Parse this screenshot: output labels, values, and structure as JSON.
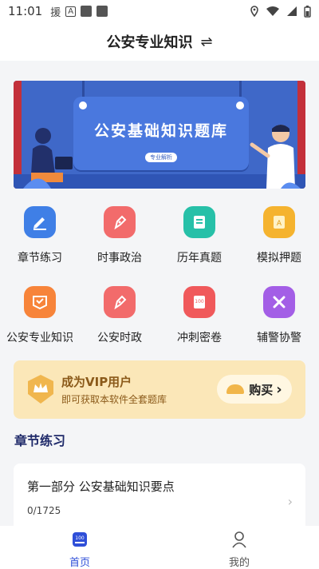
{
  "status_bar": {
    "time": "11:01",
    "notification_char": "援",
    "notification_a": "A"
  },
  "header": {
    "title": "公安专业知识",
    "switch_symbol": "⇌"
  },
  "banner": {
    "headline": "公安基础知识题库",
    "tag": "专业解析"
  },
  "grid": {
    "items": [
      {
        "label": "章节练习",
        "icon": "pencil-icon",
        "color": "#3f7fe6"
      },
      {
        "label": "时事政治",
        "icon": "pen-icon",
        "color": "#f26b6b"
      },
      {
        "label": "历年真题",
        "icon": "document-icon",
        "color": "#27c0a8"
      },
      {
        "label": "模拟押题",
        "icon": "scroll-icon",
        "color": "#f5b32f"
      },
      {
        "label": "公安专业知识",
        "icon": "shield-icon",
        "color": "#f7843a"
      },
      {
        "label": "公安时政",
        "icon": "pen-icon",
        "color": "#f26b6b"
      },
      {
        "label": "冲刺密卷",
        "icon": "exam-icon",
        "color": "#f0595b"
      },
      {
        "label": "辅警协警",
        "icon": "tools-icon",
        "color": "#a35ee6"
      }
    ]
  },
  "vip": {
    "title": "成为VIP用户",
    "subtitle": "即可获取本软件全套题库",
    "buy_label": "购买",
    "buy_chevron": "›"
  },
  "section": {
    "title": "章节练习"
  },
  "chapter_card": {
    "name": "第一部分 公安基础知识要点",
    "progress": "0/1725",
    "chevron": "›"
  },
  "tabbar": {
    "home_label": "首页",
    "home_icon_text": "100",
    "mine_label": "我的"
  },
  "colors": {
    "accent": "#2f4fd8",
    "vip_bg": "#fbe7b8",
    "banner_blue": "#3f68c8",
    "banner_red": "#c3303a"
  }
}
